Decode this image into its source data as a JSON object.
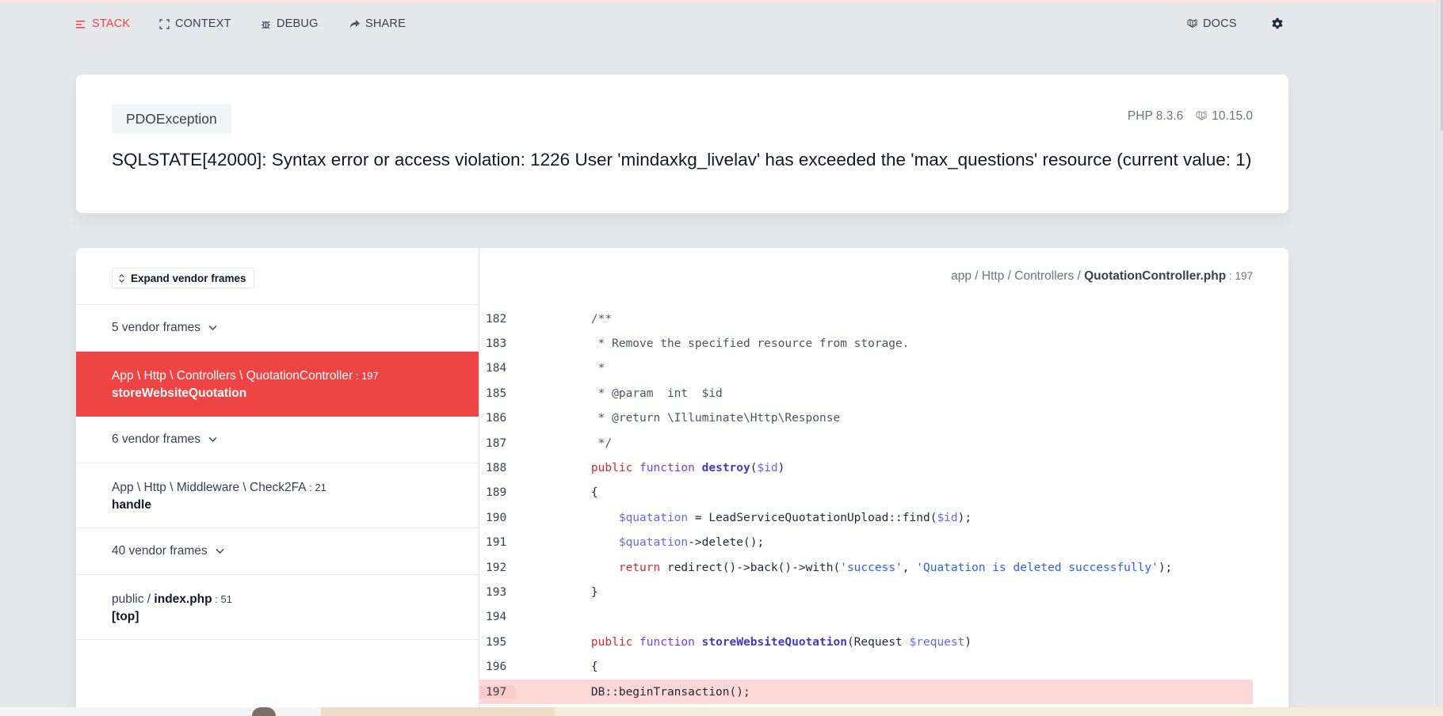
{
  "nav": {
    "stack": "STACK",
    "context": "CONTEXT",
    "debug": "DEBUG",
    "share": "SHARE",
    "docs": "DOCS"
  },
  "header": {
    "exception_class": "PDOException",
    "php_version": "PHP 8.3.6",
    "framework_version": "10.15.0",
    "message": "SQLSTATE[42000]: Syntax error or access violation: 1226 User 'mindaxkg_livelav' has exceeded the 'max_questions' resource (current value: 1)"
  },
  "frames": {
    "expand_label": "Expand vendor frames",
    "vendor_1": "5 vendor frames",
    "selected": {
      "path": "App \\ Http \\ Controllers \\ QuotationController",
      "line": " : 197",
      "method": "storeWebsiteQuotation"
    },
    "vendor_2": "6 vendor frames",
    "middleware": {
      "path": "App \\ Http \\ Middleware \\ Check2FA",
      "line": " : 21",
      "method": "handle"
    },
    "vendor_3": "40 vendor frames",
    "entry": {
      "path_prefix": "public / ",
      "file": "index.php",
      "line": " : 51",
      "method": "[top]"
    }
  },
  "code": {
    "file_path_prefix": "app / Http / Controllers / ",
    "file_name": "QuotationController.php",
    "file_line": " : 197",
    "line_numbers": [
      "182",
      "183",
      "184",
      "185",
      "186",
      "187",
      "188",
      "189",
      "190",
      "191",
      "192",
      "193",
      "194",
      "195",
      "196",
      "197"
    ]
  },
  "colors": {
    "accent": "#ef4444",
    "highlight_line": "#fed7d7",
    "background": "#e5e7eb"
  }
}
